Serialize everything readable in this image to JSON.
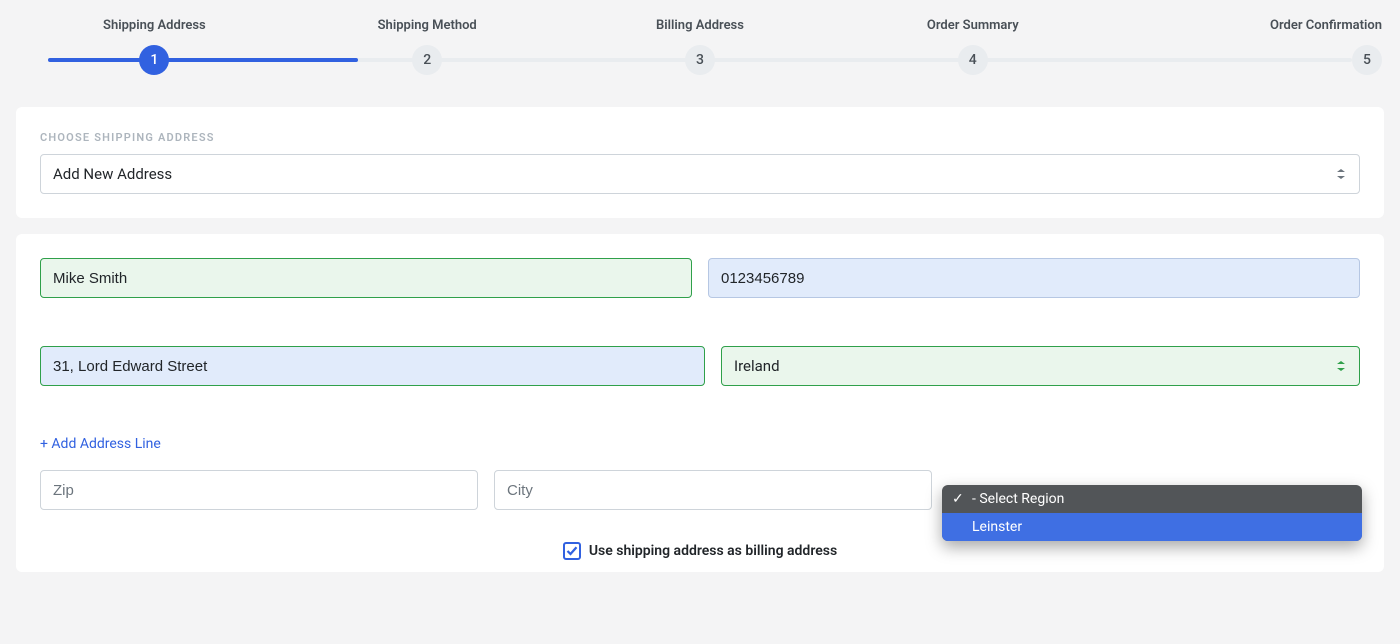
{
  "stepper": {
    "steps": [
      {
        "num": "1",
        "label": "Shipping Address",
        "active": true
      },
      {
        "num": "2",
        "label": "Shipping Method",
        "active": false
      },
      {
        "num": "3",
        "label": "Billing Address",
        "active": false
      },
      {
        "num": "4",
        "label": "Order Summary",
        "active": false
      },
      {
        "num": "5",
        "label": "Order Confirmation",
        "active": false
      }
    ]
  },
  "address_section": {
    "title": "CHOOSE SHIPPING ADDRESS",
    "select_value": "Add New Address"
  },
  "form": {
    "name_value": "Mike Smith",
    "phone_value": "0123456789",
    "street_value": "31, Lord Edward Street",
    "country_value": "Ireland",
    "add_line": "+ Add Address Line",
    "zip_placeholder": "Zip",
    "city_placeholder": "City",
    "region_value": "- Select Region",
    "region_dropdown": {
      "placeholder": "- Select Region",
      "options": [
        "Leinster"
      ]
    }
  },
  "checkbox": {
    "label": "Use shipping address as billing address",
    "checked": true
  }
}
